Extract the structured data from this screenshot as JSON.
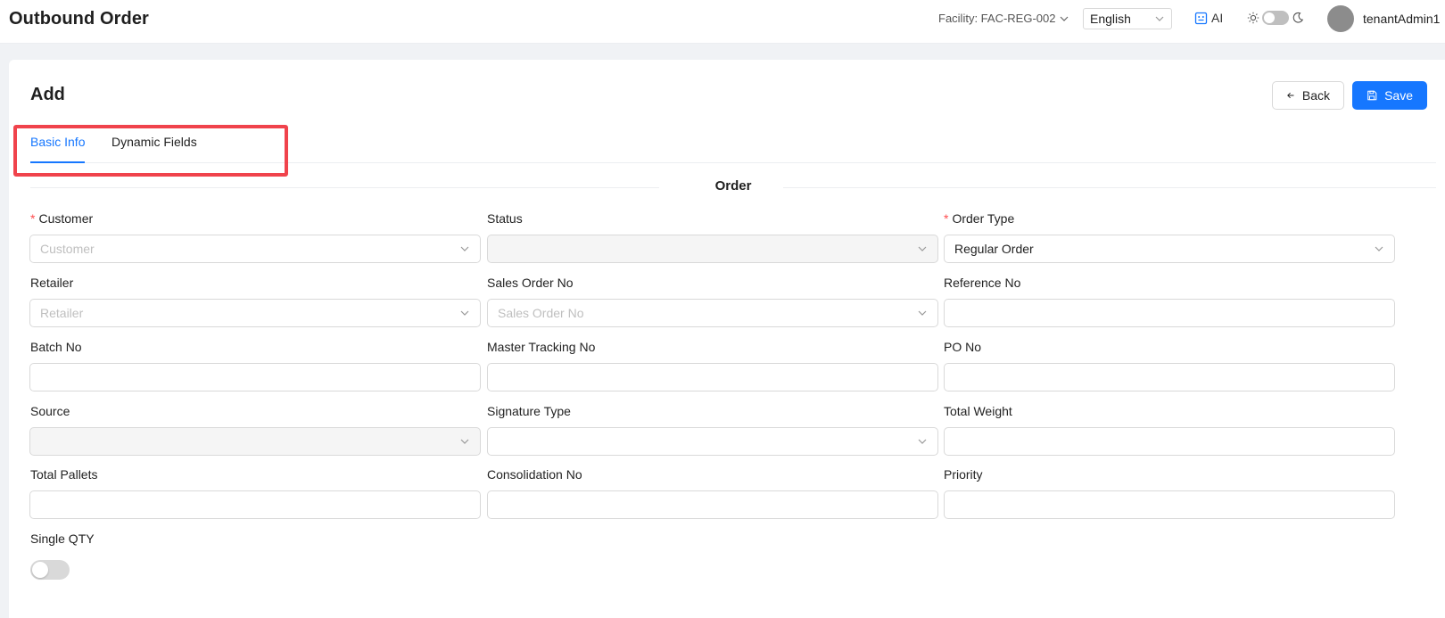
{
  "header": {
    "app_title": "Outbound Order",
    "facility_label": "Facility: FAC-REG-002",
    "language": "English",
    "ai_label": "AI",
    "username": "tenantAdmin1"
  },
  "page": {
    "title": "Add",
    "back_label": "Back",
    "save_label": "Save"
  },
  "tabs": [
    {
      "label": "Basic Info",
      "active": true
    },
    {
      "label": "Dynamic Fields",
      "active": false
    }
  ],
  "section_title": "Order",
  "form": {
    "customer": {
      "label": "Customer",
      "required": true,
      "placeholder": "Customer",
      "value": ""
    },
    "status": {
      "label": "Status",
      "value": ""
    },
    "order_type": {
      "label": "Order Type",
      "required": true,
      "value": "Regular Order"
    },
    "retailer": {
      "label": "Retailer",
      "placeholder": "Retailer",
      "value": ""
    },
    "sales_order_no": {
      "label": "Sales Order No",
      "placeholder": "Sales Order No",
      "value": ""
    },
    "reference_no": {
      "label": "Reference No",
      "value": ""
    },
    "batch_no": {
      "label": "Batch No",
      "value": ""
    },
    "master_tracking_no": {
      "label": "Master Tracking No",
      "value": ""
    },
    "po_no": {
      "label": "PO No",
      "value": ""
    },
    "source": {
      "label": "Source",
      "value": ""
    },
    "signature_type": {
      "label": "Signature Type",
      "value": ""
    },
    "total_weight": {
      "label": "Total Weight",
      "value": ""
    },
    "total_pallets": {
      "label": "Total Pallets",
      "value": ""
    },
    "consolidation_no": {
      "label": "Consolidation No",
      "value": ""
    },
    "priority": {
      "label": "Priority",
      "value": ""
    },
    "single_qty": {
      "label": "Single QTY",
      "on": false
    }
  },
  "colors": {
    "accent": "#1677ff",
    "highlight": "#f0434c",
    "required": "#ff4d4f"
  }
}
